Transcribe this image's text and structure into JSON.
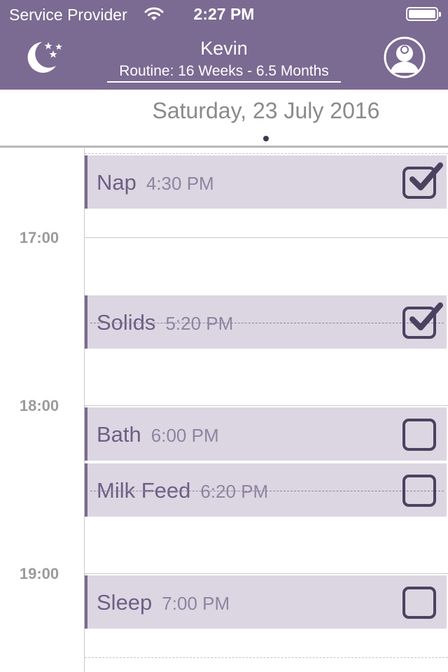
{
  "status_bar": {
    "carrier": "Service Provider",
    "time": "2:27 PM"
  },
  "nav": {
    "title": "Kevin",
    "routine": "Routine: 16 Weeks - 6.5 Months",
    "left_icon": "moon-stars-icon",
    "right_icon": "baby-profile-icon"
  },
  "date": "Saturday, 23 July 2016",
  "hours": [
    "17:00",
    "18:00",
    "19:00"
  ],
  "events": [
    {
      "name": "Nap",
      "time": "4:30 PM",
      "checked": true,
      "struck": false
    },
    {
      "name": "Solids",
      "time": "5:20 PM",
      "checked": true,
      "struck": true
    },
    {
      "name": "Bath",
      "time": "6:00 PM",
      "checked": false,
      "struck": false
    },
    {
      "name": "Milk Feed",
      "time": "6:20 PM",
      "checked": false,
      "struck": true
    },
    {
      "name": "Sleep",
      "time": "7:00 PM",
      "checked": false,
      "struck": false
    }
  ],
  "colors": {
    "header": "#7b6a92",
    "event_bg": "#dcd6e2",
    "event_accent": "#7a6a90",
    "checkbox": "#4a4260"
  }
}
